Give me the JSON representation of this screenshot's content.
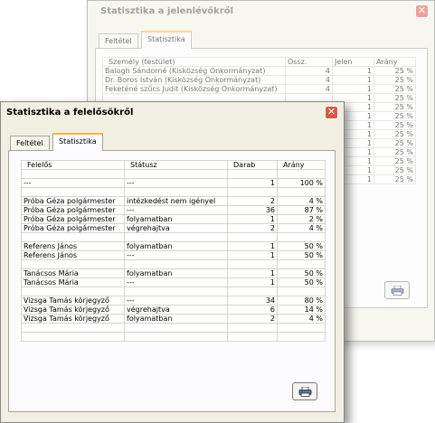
{
  "back_window": {
    "title": "Statisztika a jelenlévőkről",
    "tabs": [
      "Feltétel",
      "Statisztika"
    ],
    "columns": [
      "Személy (testület)",
      "Össz.",
      "Jelen",
      "Arány"
    ],
    "rows": [
      [
        "Balogh Sándorné (Kisközség Önkormányzat)",
        "4",
        "1",
        "25 %"
      ],
      [
        "Dr. Boros István (Kisközség Önkormányzat)",
        "4",
        "1",
        "25 %"
      ],
      [
        "Feketéné szűcs Judit (Kisközség Önkormányzat)",
        "4",
        "1",
        "25 %"
      ],
      [
        "",
        "",
        "1",
        "25 %"
      ],
      [
        "",
        "",
        "1",
        "25 %"
      ],
      [
        "",
        "",
        "1",
        "25 %"
      ],
      [
        "",
        "",
        "1",
        "25 %"
      ],
      [
        "",
        "",
        "1",
        "25 %"
      ],
      [
        "",
        "",
        "1",
        "25 %"
      ],
      [
        "",
        "",
        "1",
        "25 %"
      ],
      [
        "",
        "",
        "1",
        "25 %"
      ],
      [
        "",
        "",
        "1",
        "25 %"
      ],
      [
        "",
        "",
        "1",
        "25 %"
      ]
    ],
    "print_icon": "printer-icon",
    "close_icon": "close-icon"
  },
  "front_window": {
    "title": "Statisztika a felelősökről",
    "tabs": [
      "Feltétel",
      "Statisztika"
    ],
    "columns": [
      "Felelős",
      "Státusz",
      "Darab",
      "Arány"
    ],
    "rows": [
      [
        "",
        "",
        "",
        ""
      ],
      [
        "---",
        "---",
        "1",
        "100 %"
      ],
      [
        "",
        "",
        "",
        ""
      ],
      [
        "Próba Géza polgármester",
        "intézkedést nem igényel",
        "2",
        "4 %"
      ],
      [
        "Próba Géza polgármester",
        "---",
        "36",
        "87 %"
      ],
      [
        "Próba Géza polgármester",
        "folyamatban",
        "1",
        "2 %"
      ],
      [
        "Próba Géza polgármester",
        "végrehajtva",
        "2",
        "4 %"
      ],
      [
        "",
        "",
        "",
        ""
      ],
      [
        "Referens János",
        "folyamatban",
        "1",
        "50 %"
      ],
      [
        "Referens János",
        "---",
        "1",
        "50 %"
      ],
      [
        "",
        "",
        "",
        ""
      ],
      [
        "Tanácsos Mária",
        "folyamatban",
        "1",
        "50 %"
      ],
      [
        "Tanácsos Mária",
        "---",
        "1",
        "50 %"
      ],
      [
        "",
        "",
        "",
        ""
      ],
      [
        "Vizsga Tamás körjegyző",
        "---",
        "34",
        "80 %"
      ],
      [
        "Vizsga Tamás körjegyző",
        "végrehajtva",
        "6",
        "14 %"
      ],
      [
        "Vizsga Tamás körjegyző",
        "folyamatban",
        "2",
        "4 %"
      ],
      [
        "",
        "",
        "",
        ""
      ],
      [
        "",
        "",
        "",
        ""
      ]
    ],
    "print_icon": "printer-icon",
    "close_icon": "close-icon"
  }
}
